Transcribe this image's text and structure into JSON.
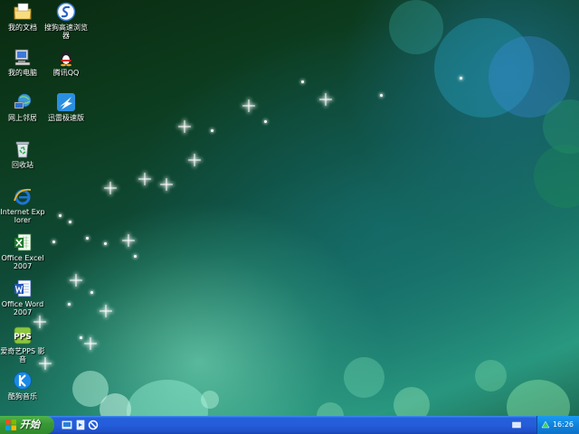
{
  "desktop": {
    "icons": [
      {
        "label": "我的文档",
        "icon": "my-documents-icon"
      },
      {
        "label": "搜狗高速浏览器",
        "icon": "sogou-browser-icon"
      },
      {
        "label": "我的电脑",
        "icon": "my-computer-icon"
      },
      {
        "label": "腾讯QQ",
        "icon": "qq-penguin-icon"
      },
      {
        "label": "网上邻居",
        "icon": "network-neighborhood-icon"
      },
      {
        "label": "迅雷极速版",
        "icon": "thunder-icon"
      },
      {
        "label": "回收站",
        "icon": "recycle-bin-icon"
      },
      {
        "label": "Internet Explorer",
        "icon": "internet-explorer-icon"
      },
      {
        "label": "Office Excel 2007",
        "icon": "excel-icon"
      },
      {
        "label": "Office Word 2007",
        "icon": "word-icon"
      },
      {
        "label": "爱奇艺PPS 影音",
        "icon": "pps-player-icon"
      },
      {
        "label": "酷狗音乐",
        "icon": "kugou-music-icon"
      }
    ]
  },
  "taskbar": {
    "start_label": "开始",
    "quick_launch": [
      "desktop-show-icon",
      "media-player-icon",
      "stop-icon"
    ],
    "clock": "16:26"
  },
  "colors": {
    "taskbar_blue": "#245ddb",
    "start_green": "#3a9a37",
    "tray_blue": "#0f83dd"
  }
}
